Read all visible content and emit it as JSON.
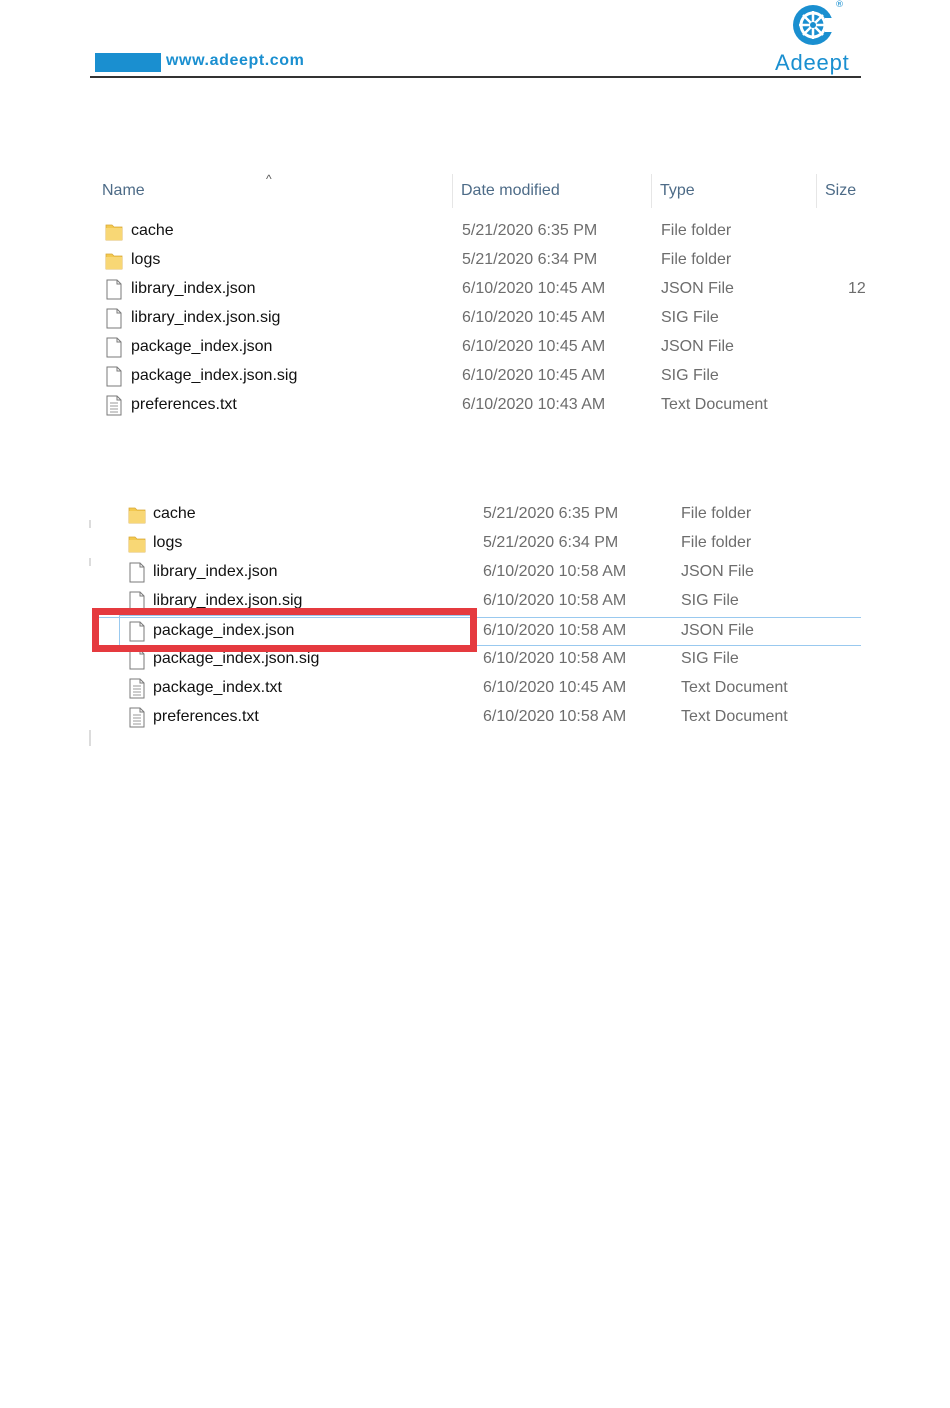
{
  "header": {
    "url": "www.adeept.com",
    "brand": "Adeept",
    "colors": {
      "accent": "#1a8fd0",
      "highlight": "#e53a3f",
      "selection": "#99c9ef"
    }
  },
  "panel1": {
    "columns": {
      "name": "Name",
      "date": "Date modified",
      "type": "Type",
      "size": "Size"
    },
    "sort_indicator": "^",
    "rows": [
      {
        "icon": "folder-icon",
        "name": "cache",
        "date": "5/21/2020 6:35 PM",
        "type": "File folder",
        "size": ""
      },
      {
        "icon": "folder-icon",
        "name": "logs",
        "date": "5/21/2020 6:34 PM",
        "type": "File folder",
        "size": ""
      },
      {
        "icon": "file-icon",
        "name": "library_index.json",
        "date": "6/10/2020 10:45 AM",
        "type": "JSON File",
        "size": "12"
      },
      {
        "icon": "file-icon",
        "name": "library_index.json.sig",
        "date": "6/10/2020 10:45 AM",
        "type": "SIG File",
        "size": ""
      },
      {
        "icon": "file-icon",
        "name": "package_index.json",
        "date": "6/10/2020 10:45 AM",
        "type": "JSON File",
        "size": ""
      },
      {
        "icon": "file-icon",
        "name": "package_index.json.sig",
        "date": "6/10/2020 10:45 AM",
        "type": "SIG File",
        "size": ""
      },
      {
        "icon": "text-file-icon",
        "name": "preferences.txt",
        "date": "6/10/2020 10:43 AM",
        "type": "Text Document",
        "size": ""
      }
    ]
  },
  "panel2": {
    "rows": [
      {
        "icon": "folder-icon",
        "name": "cache",
        "date": "5/21/2020 6:35 PM",
        "type": "File folder"
      },
      {
        "icon": "folder-icon",
        "name": "logs",
        "date": "5/21/2020 6:34 PM",
        "type": "File folder"
      },
      {
        "icon": "file-icon",
        "name": "library_index.json",
        "date": "6/10/2020 10:58 AM",
        "type": "JSON File"
      },
      {
        "icon": "file-icon",
        "name": "library_index.json.sig",
        "date": "6/10/2020 10:58 AM",
        "type": "SIG File"
      },
      {
        "icon": "file-icon",
        "name": "package_index.json",
        "date": "6/10/2020 10:58 AM",
        "type": "JSON File",
        "selected": true
      },
      {
        "icon": "file-icon",
        "name": "package_index.json.sig",
        "date": "6/10/2020 10:58 AM",
        "type": "SIG File"
      },
      {
        "icon": "text-file-icon",
        "name": "package_index.txt",
        "date": "6/10/2020 10:45 AM",
        "type": "Text Document"
      },
      {
        "icon": "text-file-icon",
        "name": "preferences.txt",
        "date": "6/10/2020 10:58 AM",
        "type": "Text Document"
      }
    ]
  }
}
